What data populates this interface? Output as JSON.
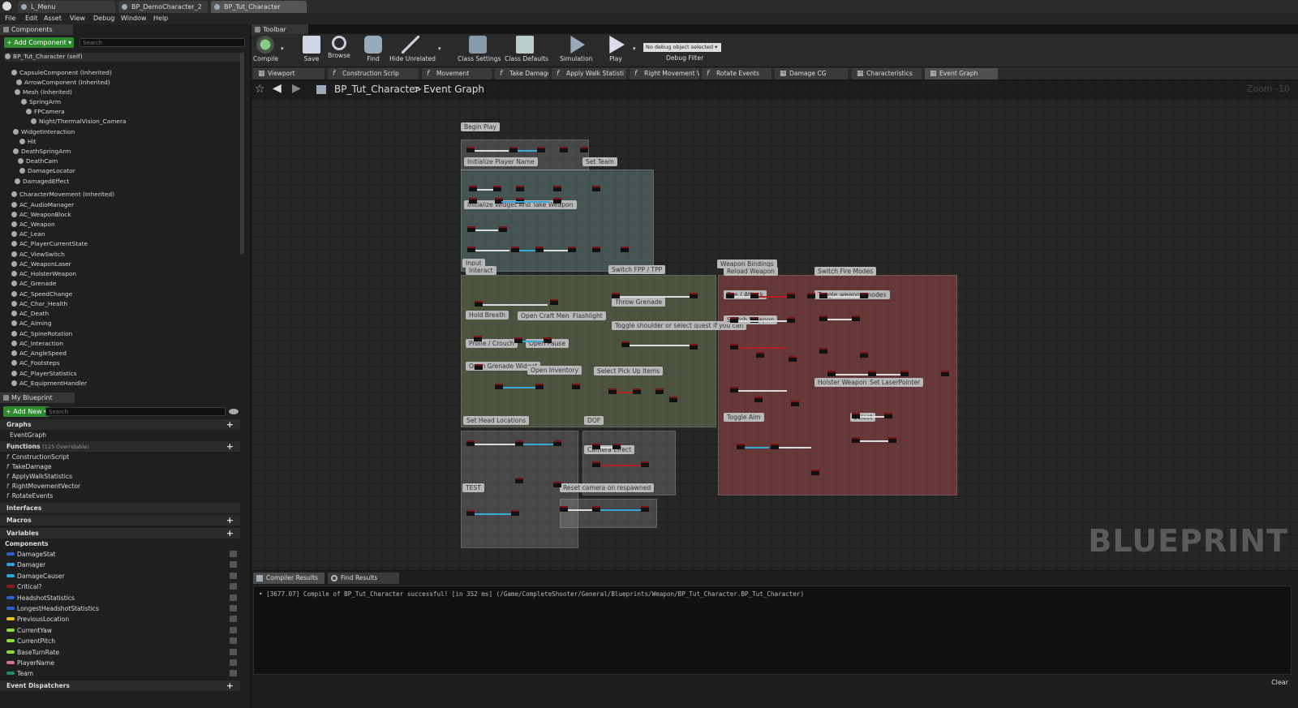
{
  "doc_tabs": [
    "L_Menu",
    "BP_DemoCharacter_2",
    "BP_Tut_Character"
  ],
  "menu": [
    "File",
    "Edit",
    "Asset",
    "View",
    "Debug",
    "Window",
    "Help"
  ],
  "components_panel": {
    "title": "Components",
    "add_button": "+ Add Component ▾",
    "search_placeholder": "Search",
    "self_item": "BP_Tut_Character (self)",
    "items": [
      "CapsuleComponent (Inherited)",
      "ArrowComponent (Inherited)",
      "Mesh (Inherited)",
      "SpringArm",
      "FPCamera",
      "Night/ThermalVision_Camera",
      "WidgetInteraction",
      "Hit",
      "DeathSpringArm",
      "DeathCam",
      "DamageLocator",
      "DamagedEffect",
      "CharacterMovement (Inherited)",
      "AC_AudioManager",
      "AC_WeaponBlock",
      "AC_Weapon",
      "AC_Lean",
      "AC_PlayerCurrentState",
      "AC_ViewSwitch",
      "AC_WeaponLaser",
      "AC_HolsterWeapon",
      "AC_Grenade",
      "AC_SpeedChange",
      "AC_Char_Health",
      "AC_Death",
      "AC_Aiming",
      "AC_SpineRotation",
      "AC_Interaction",
      "AC_AngleSpeed",
      "AC_Footsteps",
      "AC_PlayerStatistics",
      "AC_EquipmentHandler"
    ]
  },
  "my_blueprint": {
    "title": "My Blueprint",
    "add_button": "+ Add New ▾",
    "search_placeholder": "Search",
    "graphs_label": "Graphs",
    "graphs": [
      "EventGraph"
    ],
    "functions_label": "Functions",
    "functions_note": "(125 Overridable)",
    "functions": [
      "ConstructionScript",
      "TakeDamage",
      "ApplyWalkStatistics",
      "RightMovementVector",
      "RotateEvents"
    ],
    "interfaces_label": "Interfaces",
    "macros_label": "Macros",
    "variables_label": "Variables",
    "components_label": "Components",
    "variables": [
      {
        "name": "DamageStat",
        "color": "#2a5fd0"
      },
      {
        "name": "Damager",
        "color": "#27a6e0"
      },
      {
        "name": "DamageCauser",
        "color": "#27a6e0"
      },
      {
        "name": "Critical?",
        "color": "#8a1a1a"
      },
      {
        "name": "HeadshotStatistics",
        "color": "#2a5fd0"
      },
      {
        "name": "LongestHeadshotStatistics",
        "color": "#2a5fd0"
      },
      {
        "name": "PreviousLocation",
        "color": "#e8c020"
      },
      {
        "name": "CurrentYaw",
        "color": "#8fdc3a"
      },
      {
        "name": "CurrentPitch",
        "color": "#8fdc3a"
      },
      {
        "name": "BaseTurnRate",
        "color": "#8fdc3a"
      },
      {
        "name": "PlayerName",
        "color": "#e06a9a"
      },
      {
        "name": "Team",
        "color": "#1f8a6a"
      }
    ],
    "event_dispatchers_label": "Event Dispatchers"
  },
  "toolbar": {
    "title": "Toolbar",
    "buttons": [
      "Compile",
      "Save",
      "Browse",
      "Find",
      "Hide Unrelated",
      "Class Settings",
      "Class Defaults",
      "Simulation",
      "Play"
    ],
    "debug_select": "No debug object selected ▾",
    "debug_label": "Debug Filter"
  },
  "graph_tabs": [
    "Viewport",
    "Construction Scrip",
    "Movement",
    "Take Damage",
    "Apply Walk Statisti",
    "Right Movement V",
    "Rotate Events",
    "Damage CG",
    "Characteristics",
    "Event Graph"
  ],
  "breadcrumb": {
    "root": "BP_Tut_Character",
    "sep": ">",
    "current": "Event Graph"
  },
  "zoom_label": "Zoom -10",
  "watermark": "BLUEPRINT",
  "comments": [
    "Begin Play",
    "Initialize Player Name",
    "Set Team",
    "Initialize Widget And Take Weapon",
    "Input",
    "Interact",
    "Switch FPP / TPP",
    "Hold Breath",
    "Open Craft Menu",
    "Flashlight",
    "Throw Grenade",
    "Toggle shoulder or select quest if you can",
    "Prone / Crouch",
    "Open Pause",
    "Open Grenade Widget",
    "Open Inventory",
    "Select Pick Up Items",
    "Set Head Locations",
    "DOF",
    "Camera Effect",
    "TEST",
    "Reset camera on respawned",
    "Weapon Bindings",
    "Reload Weapon",
    "Switch Fire Modes",
    "Fire / Attack",
    "Toggle weapon modes",
    "Switch Weapon",
    "Holster Weapon",
    "Set LaserPointer",
    "Toggle Aim",
    "Select"
  ],
  "bottom": {
    "tabs": [
      "Compiler Results",
      "Find Results"
    ],
    "log": "[3677.07] Compile of BP_Tut_Character successful! [in 352 ms] (/Game/CompleteShooter/General/Blueprints/Weapon/BP_Tut_Character.BP_Tut_Character)",
    "clear": "Clear"
  }
}
